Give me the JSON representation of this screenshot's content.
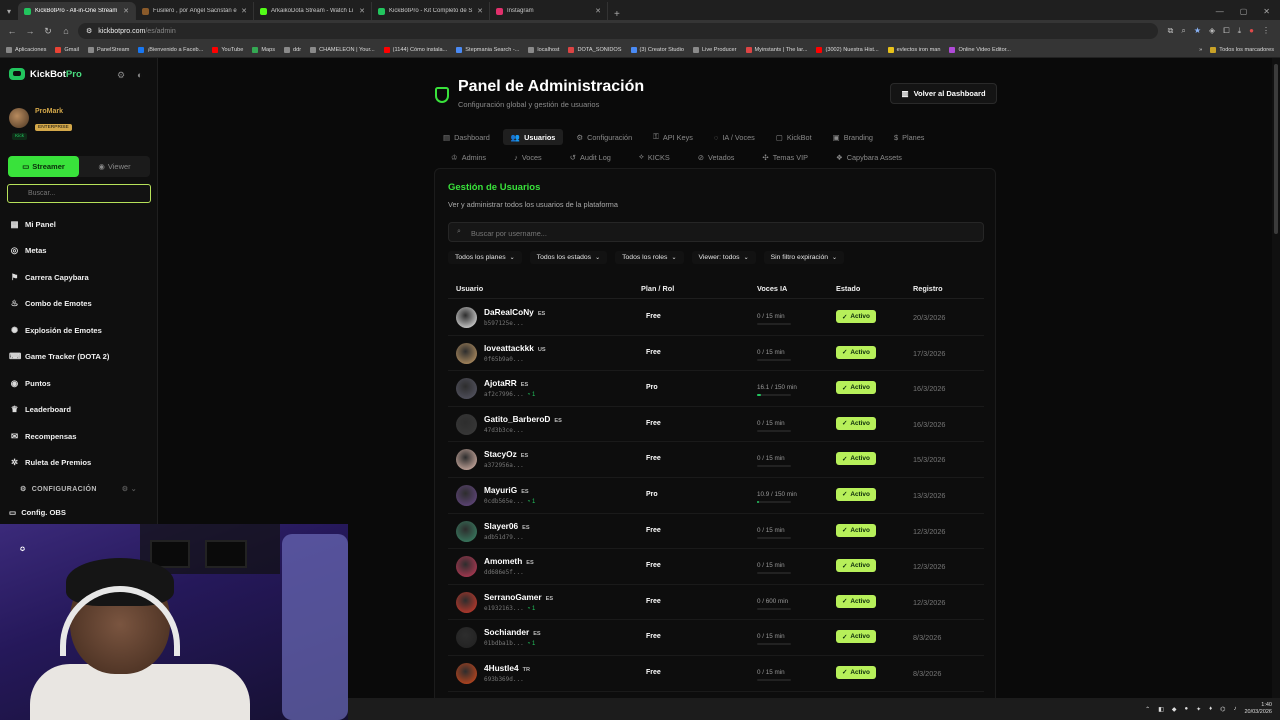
{
  "browser": {
    "tabs": [
      {
        "title": "KickBotPro - All-in-One Stream",
        "color": "#22c55e",
        "active": true
      },
      {
        "title": "Fusilero , por Ángel Sacristán e",
        "color": "#8a5a2a",
        "active": false
      },
      {
        "title": "ArkaikoDota Stream - Watch Li",
        "color": "#53fc18",
        "active": false
      },
      {
        "title": "KickBotPro - Kit Completo de S",
        "color": "#22c55e",
        "active": false
      },
      {
        "title": "Instagram",
        "color": "#e1306c",
        "active": false
      }
    ],
    "url_host": "kickbotpro.com",
    "url_path": "/es/admin",
    "bookmarks": [
      "Aplicaciones",
      "Gmail",
      "PanelStream",
      "¡Bienvenido a Faceb...",
      "YouTube",
      "Maps",
      "ddr",
      "CHAMELEON | Your...",
      "(1144) Cómo instala...",
      "Stepmania Search -...",
      "localhost",
      "DOTA_SONIDOS",
      "(3) Creator Studio",
      "Live Producer",
      "Myinstants | The lar...",
      "(3002) Nuestra Hist...",
      "evlectos iron man",
      "Online Video Editor..."
    ],
    "bookmarks_right": "Todos los marcadores"
  },
  "sidebar": {
    "brand_a": "KickBot",
    "brand_b": "Pro",
    "user_name": "ProMark",
    "user_tier": "ENTERPRISE",
    "platform_badge": "Kick",
    "mode_streamer": "Streamer",
    "mode_viewer": "Viewer",
    "search_placeholder": "Buscar...",
    "items": [
      {
        "label": "Mi Panel",
        "icon": "grid-icon",
        "glyph": "▦"
      },
      {
        "label": "Metas",
        "icon": "target-icon",
        "glyph": "◎"
      },
      {
        "label": "Carrera Capybara",
        "icon": "race-icon",
        "glyph": "⚑"
      },
      {
        "label": "Combo de Emotes",
        "icon": "flame-icon",
        "glyph": "♨"
      },
      {
        "label": "Explosión de Emotes",
        "icon": "burst-icon",
        "glyph": "✺"
      },
      {
        "label": "Game Tracker (DOTA 2)",
        "icon": "gamepad-icon",
        "glyph": "⌨"
      },
      {
        "label": "Puntos",
        "icon": "coin-icon",
        "glyph": "◉"
      },
      {
        "label": "Leaderboard",
        "icon": "trophy-icon",
        "glyph": "♛"
      },
      {
        "label": "Recompensas",
        "icon": "gift-icon",
        "glyph": "✉"
      },
      {
        "label": "Ruleta de Premios",
        "icon": "wheel-icon",
        "glyph": "✲"
      }
    ],
    "config_heading": "CONFIGURACIÓN",
    "obs_label": "Config. OBS"
  },
  "header": {
    "title": "Panel de Administración",
    "subtitle": "Configuración global y gestión de usuarios",
    "back_button": "Volver al Dashboard"
  },
  "tabs_row1": [
    {
      "label": "Dashboard",
      "glyph": "▤",
      "active": false
    },
    {
      "label": "Usuarios",
      "glyph": "👥",
      "active": true
    },
    {
      "label": "Configuración",
      "glyph": "⚙",
      "active": false
    },
    {
      "label": "API Keys",
      "glyph": "⚿",
      "active": false
    },
    {
      "label": "IA / Voces",
      "glyph": "◌",
      "active": false
    },
    {
      "label": "KickBot",
      "glyph": "▢",
      "active": false
    },
    {
      "label": "Branding",
      "glyph": "▣",
      "active": false
    },
    {
      "label": "Planes",
      "glyph": "$",
      "active": false
    }
  ],
  "tabs_row2": [
    {
      "label": "Admins",
      "glyph": "♔"
    },
    {
      "label": "Voces",
      "glyph": "♪"
    },
    {
      "label": "Audit Log",
      "glyph": "↺"
    },
    {
      "label": "KICKS",
      "glyph": "⟡"
    },
    {
      "label": "Vetados",
      "glyph": "⊘"
    },
    {
      "label": "Temas VIP",
      "glyph": "✣"
    },
    {
      "label": "Capybara Assets",
      "glyph": "❖"
    }
  ],
  "users_panel": {
    "title": "Gestión de Usuarios",
    "subtitle": "Ver y administrar todos los usuarios de la plataforma",
    "search_placeholder": "Buscar por username...",
    "filters": [
      "Todos los planes",
      "Todos los estados",
      "Todos los roles",
      "Viewer: todos",
      "Sin filtro expiración"
    ],
    "columns": {
      "user": "Usuario",
      "plan": "Plan / Rol",
      "voices": "Voces IA",
      "status": "Estado",
      "registered": "Registro"
    }
  },
  "users": [
    {
      "name": "DaRealCoNy",
      "lang": "ES",
      "id": "b597125e...",
      "kick": "",
      "plan": "Free",
      "voices": "0 / 15 min",
      "voice_pct": 0,
      "status": "Activo",
      "date": "20/3/2026",
      "av": "#f5f5f5"
    },
    {
      "name": "loveattackkk",
      "lang": "US",
      "id": "0f65b9a0...",
      "kick": "",
      "plan": "Free",
      "voices": "0 / 15 min",
      "voice_pct": 0,
      "status": "Activo",
      "date": "17/3/2026",
      "av": "#c9a06a"
    },
    {
      "name": "AjotaRR",
      "lang": "ES",
      "id": "af2c7996...",
      "kick": "◔ 1",
      "plan": "Pro",
      "voices": "16.1 / 150 min",
      "voice_pct": 10.7,
      "status": "Activo",
      "date": "16/3/2026",
      "av": "#5a5a6a"
    },
    {
      "name": "Gatito_BarberoD",
      "lang": "ES",
      "id": "47d3b3ce...",
      "kick": "",
      "plan": "Free",
      "voices": "0 / 15 min",
      "voice_pct": 0,
      "status": "Activo",
      "date": "16/3/2026",
      "av": "#3a3a3a"
    },
    {
      "name": "StacyOz",
      "lang": "ES",
      "id": "a372956a...",
      "kick": "",
      "plan": "Free",
      "voices": "0 / 15 min",
      "voice_pct": 0,
      "status": "Activo",
      "date": "15/3/2026",
      "av": "#e8c2b5"
    },
    {
      "name": "MayuriG",
      "lang": "ES",
      "id": "0cdb565e...",
      "kick": "◔ 1",
      "plan": "Pro",
      "voices": "10.9 / 150 min",
      "voice_pct": 7.3,
      "status": "Activo",
      "date": "13/3/2026",
      "av": "#6a4a8a"
    },
    {
      "name": "Slayer06",
      "lang": "ES",
      "id": "adb51d79...",
      "kick": "",
      "plan": "Free",
      "voices": "0 / 15 min",
      "voice_pct": 0,
      "status": "Activo",
      "date": "12/3/2026",
      "av": "#3a8a6a"
    },
    {
      "name": "Amometh",
      "lang": "ES",
      "id": "dd686e5f...",
      "kick": "",
      "plan": "Free",
      "voices": "0 / 15 min",
      "voice_pct": 0,
      "status": "Activo",
      "date": "12/3/2026",
      "av": "#c83a5a"
    },
    {
      "name": "SerranoGamer",
      "lang": "ES",
      "id": "e1932163...",
      "kick": "◔ 1",
      "plan": "Free",
      "voices": "0 / 600 min",
      "voice_pct": 0,
      "status": "Activo",
      "date": "12/3/2026",
      "av": "#d83a2a"
    },
    {
      "name": "Sochiander",
      "lang": "ES",
      "id": "01bdba1b...",
      "kick": "◔ 1",
      "plan": "Free",
      "voices": "0 / 15 min",
      "voice_pct": 0,
      "status": "Activo",
      "date": "8/3/2026",
      "av": "#202020"
    },
    {
      "name": "4Hustle4",
      "lang": "TR",
      "id": "693b369d...",
      "kick": "",
      "plan": "Free",
      "voices": "0 / 15 min",
      "voice_pct": 0,
      "status": "Activo",
      "date": "8/3/2026",
      "av": "#d84a1a"
    }
  ],
  "taskbar": {
    "time": "1:40",
    "date": "20/03/2026"
  },
  "colors": {
    "accent": "#39e23b",
    "badge": "#b7f05a",
    "bg": "#0a0a0a"
  }
}
